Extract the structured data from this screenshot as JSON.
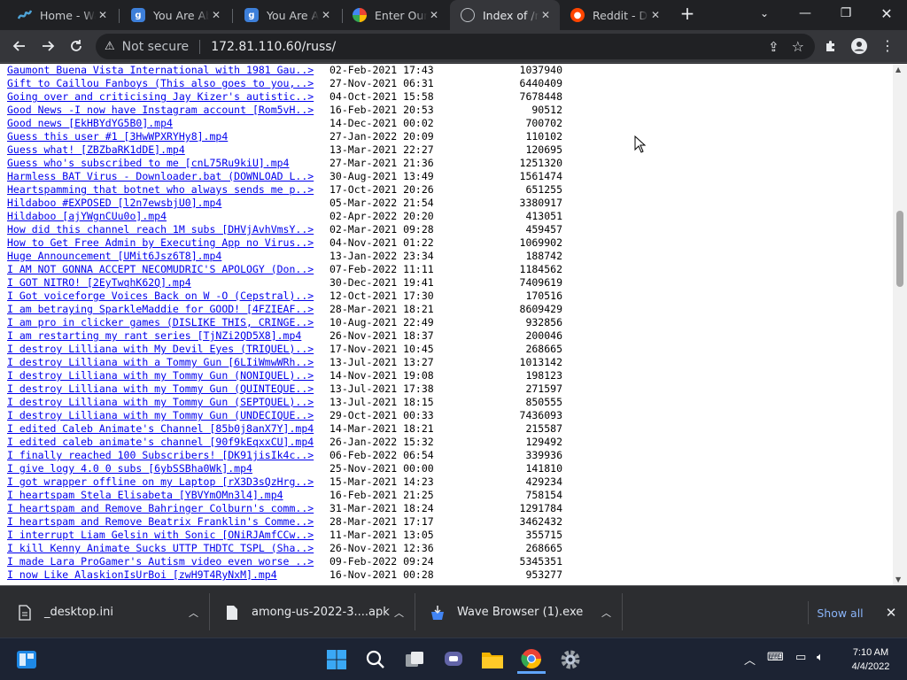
{
  "tabs": [
    {
      "title": "Home - Wattpad",
      "icon": "wattpad-icon",
      "active": false
    },
    {
      "title": "You Are About To...",
      "icon": "g-site-icon",
      "active": false
    },
    {
      "title": "You Are About To...",
      "icon": "g-site-icon",
      "active": false
    },
    {
      "title": "Enter Our Giveaway",
      "icon": "pinwheel-icon",
      "active": false
    },
    {
      "title": "Index of /russ/",
      "icon": "globe-icon",
      "active": true
    },
    {
      "title": "Reddit - Dive into",
      "icon": "reddit-icon",
      "active": false
    }
  ],
  "toolbar": {
    "security_label": "Not secure",
    "url": "172.81.110.60/russ/"
  },
  "listing": [
    {
      "name": "Gaumont Buena Vista International with 1981 Gau..>",
      "date": "02-Feb-2021 17:43",
      "size": "1037940"
    },
    {
      "name": "Gift to Caillou Fanboys (This also goes to you,..>",
      "date": "27-Nov-2021 06:31",
      "size": "6440409"
    },
    {
      "name": "Going over and criticising Jay Kizer's autistic..>",
      "date": "04-Oct-2021 15:58",
      "size": "7678448"
    },
    {
      "name": "Good News -I now have Instagram account [Rom5vH..>",
      "date": "16-Feb-2021 20:53",
      "size": "90512"
    },
    {
      "name": "Good news [EkHBYdYG5B0].mp4",
      "date": "14-Dec-2021 00:02",
      "size": "700702"
    },
    {
      "name": "Guess this user #1 [3HwWPXRYHy8].mp4",
      "date": "27-Jan-2022 20:09",
      "size": "110102"
    },
    {
      "name": "Guess what! [ZBZbaRK1dDE].mp4",
      "date": "13-Mar-2021 22:27",
      "size": "120695"
    },
    {
      "name": "Guess who's subscribed to me [cnL75Ru9kiU].mp4",
      "date": "27-Mar-2021 21:36",
      "size": "1251320"
    },
    {
      "name": "Harmless BAT Virus - Downloader.bat (DOWNLOAD L..>",
      "date": "30-Aug-2021 13:49",
      "size": "1561474"
    },
    {
      "name": "Heartspamming that botnet who always sends me p..>",
      "date": "17-Oct-2021 20:26",
      "size": "651255"
    },
    {
      "name": "Hildaboo #EXPOSED [l2n7ewsbjU0].mp4",
      "date": "05-Mar-2022 21:54",
      "size": "3380917"
    },
    {
      "name": "Hildaboo [ajYWgnCUu0o].mp4",
      "date": "02-Apr-2022 20:20",
      "size": "413051"
    },
    {
      "name": "How did this channel reach 1M subs [DHVjAvhVmsY..>",
      "date": "02-Mar-2021 09:28",
      "size": "459457"
    },
    {
      "name": "How to Get Free Admin by Executing App no Virus..>",
      "date": "04-Nov-2021 01:22",
      "size": "1069902"
    },
    {
      "name": "Huge Announcement [UMit6Jsz6T8].mp4",
      "date": "13-Jan-2022 23:34",
      "size": "188742"
    },
    {
      "name": "I AM NOT GONNA ACCEPT NECOMUDRIC'S APOLOGY (Don..>",
      "date": "07-Feb-2022 11:11",
      "size": "1184562"
    },
    {
      "name": "I GOT NITRO! [2EyTwqhK62Q].mp4",
      "date": "30-Dec-2021 19:41",
      "size": "7409619"
    },
    {
      "name": "I Got voiceforge Voices Back on W -O (Cepstral)..>",
      "date": "12-Oct-2021 17:30",
      "size": "170516"
    },
    {
      "name": "I am betraying SparkleMaddie for GOOD! [4FZIEAF..>",
      "date": "28-Mar-2021 18:21",
      "size": "8609429"
    },
    {
      "name": "I am pro in clicker games (DISLIKE THIS, CRINGE..>",
      "date": "10-Aug-2021 22:49",
      "size": "932856"
    },
    {
      "name": "I am restarting my rant series [TjNZi2QD5X8].mp4",
      "date": "26-Nov-2021 18:37",
      "size": "200046"
    },
    {
      "name": "I destroy Lilliana with My Devil Eyes (TRIQUEL)..>",
      "date": "17-Nov-2021 10:45",
      "size": "268665"
    },
    {
      "name": "I destroy Lilliana with a Tommy Gun [6LIiWmwWRh..>",
      "date": "13-Jul-2021 13:27",
      "size": "1013142"
    },
    {
      "name": "I destroy Lilliana with my Tommy Gun (NONIQUEL)..>",
      "date": "14-Nov-2021 19:08",
      "size": "198123"
    },
    {
      "name": "I destroy Lilliana with my Tommy Gun (QUINTEQUE..>",
      "date": "13-Jul-2021 17:38",
      "size": "271597"
    },
    {
      "name": "I destroy Lilliana with my Tommy Gun (SEPTQUEL)..>",
      "date": "13-Jul-2021 18:15",
      "size": "850555"
    },
    {
      "name": "I destroy Lilliana with my Tommy Gun (UNDECIQUE..>",
      "date": "29-Oct-2021 00:33",
      "size": "7436093"
    },
    {
      "name": "I edited Caleb Animate's Channel [85b0j8anX7Y].mp4",
      "date": "14-Mar-2021 18:21",
      "size": "215587"
    },
    {
      "name": "I edited caleb animate's channel [90f9kEqxxCU].mp4",
      "date": "26-Jan-2022 15:32",
      "size": "129492"
    },
    {
      "name": "I finally reached 100 Subscribers! [DK91jisIk4c..>",
      "date": "06-Feb-2022 06:54",
      "size": "339936"
    },
    {
      "name": "I give logy 4.0 0 subs [6ybSSBha0Wk].mp4",
      "date": "25-Nov-2021 00:00",
      "size": "141810"
    },
    {
      "name": "I got wrapper offline on my Laptop [rX3D3sQzHrg..>",
      "date": "15-Mar-2021 14:23",
      "size": "429234"
    },
    {
      "name": "I heartspam Stela Elisabeta [YBVYmOMn3l4].mp4",
      "date": "16-Feb-2021 21:25",
      "size": "758154"
    },
    {
      "name": "I heartspam and Remove Bahringer Colburn's comm..>",
      "date": "31-Mar-2021 18:24",
      "size": "1291784"
    },
    {
      "name": "I heartspam and Remove Beatrix Franklin's Comme..>",
      "date": "28-Mar-2021 17:17",
      "size": "3462432"
    },
    {
      "name": "I interrupt Liam Gelsin with Sonic [ONiRJAmfCCw..>",
      "date": "11-Mar-2021 13:05",
      "size": "355715"
    },
    {
      "name": "I kill Kenny Animate Sucks UTTP THDTC TSPL (Sha..>",
      "date": "26-Nov-2021 12:36",
      "size": "268665"
    },
    {
      "name": "I made Lara ProGamer's Autism video even worse ..>",
      "date": "09-Feb-2022 09:24",
      "size": "5345351"
    },
    {
      "name": "I now Like AlaskionIsUrBoi [zwH9T4RyNxM].mp4",
      "date": "16-Nov-2021 00:28",
      "size": "953277"
    }
  ],
  "downloads": [
    {
      "filename": "_desktop.ini",
      "icon": "document-icon"
    },
    {
      "filename": "among-us-2022-3....apk",
      "icon": "document-icon"
    },
    {
      "filename": "Wave Browser (1).exe",
      "icon": "installer-icon"
    }
  ],
  "downloads_show_all": "Show all",
  "clock": {
    "time": "7:10 AM",
    "date": "4/4/2022"
  },
  "colors": {
    "link": "#0000ee",
    "tab_bar": "#202124",
    "toolbar": "#35363a",
    "taskbar": "#1c2333"
  }
}
